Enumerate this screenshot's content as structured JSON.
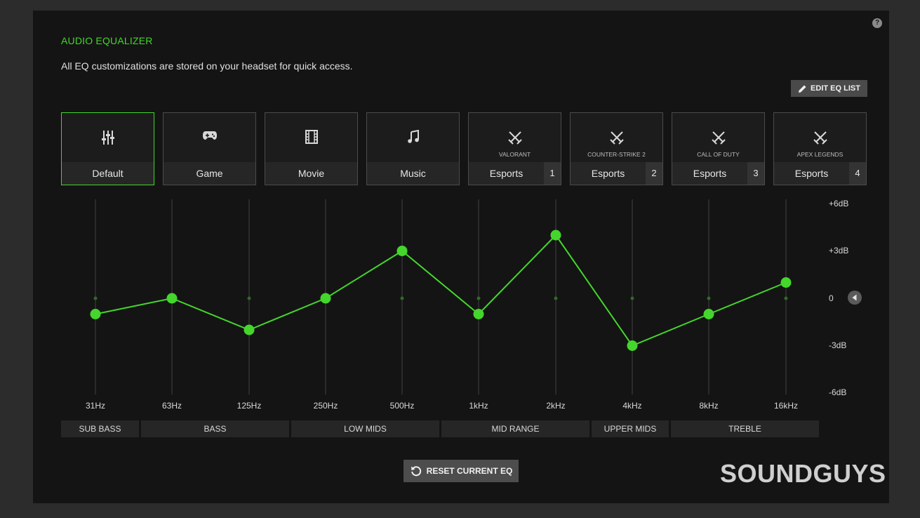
{
  "header": {
    "title": "AUDIO EQUALIZER",
    "subtitle": "All EQ customizations are stored on your headset for quick access.",
    "help_label": "?"
  },
  "toolbar": {
    "edit_label": "EDIT EQ LIST",
    "edit_icon": "pencil-icon"
  },
  "presets": [
    {
      "name": "Default",
      "icon": "sliders-icon",
      "active": true
    },
    {
      "name": "Game",
      "icon": "gamepad-icon"
    },
    {
      "name": "Movie",
      "icon": "film-icon"
    },
    {
      "name": "Music",
      "icon": "music-note-icon"
    },
    {
      "name": "Esports",
      "tag": "VALORANT",
      "number": "1",
      "icon": "crossed-swords-icon"
    },
    {
      "name": "Esports",
      "tag": "COUNTER-STRIKE 2",
      "number": "2",
      "icon": "crossed-swords-icon"
    },
    {
      "name": "Esports",
      "tag": "CALL OF DUTY",
      "number": "3",
      "icon": "crossed-swords-icon"
    },
    {
      "name": "Esports",
      "tag": "APEX LEGENDS",
      "number": "4",
      "icon": "crossed-swords-icon"
    }
  ],
  "eq": {
    "db_labels": [
      "+6dB",
      "+3dB",
      "0",
      "-3dB",
      "-6dB"
    ],
    "db_range": [
      -6,
      6
    ],
    "bands": [
      {
        "freq": "31Hz",
        "gain": -1
      },
      {
        "freq": "63Hz",
        "gain": 0
      },
      {
        "freq": "125Hz",
        "gain": -2
      },
      {
        "freq": "250Hz",
        "gain": 0
      },
      {
        "freq": "500Hz",
        "gain": 3
      },
      {
        "freq": "1kHz",
        "gain": -1
      },
      {
        "freq": "2kHz",
        "gain": 4
      },
      {
        "freq": "4kHz",
        "gain": -3
      },
      {
        "freq": "8kHz",
        "gain": -1
      },
      {
        "freq": "16kHz",
        "gain": 1
      }
    ],
    "ranges": [
      "SUB BASS",
      "BASS",
      "LOW MIDS",
      "MID RANGE",
      "UPPER MIDS",
      "TREBLE"
    ]
  },
  "footer": {
    "reset_label": "RESET CURRENT EQ"
  },
  "brand": {
    "logo": "SOUNDGUYS"
  },
  "colors": {
    "accent": "#44d62c",
    "panel": "#141414",
    "background": "#2c2c2c"
  }
}
